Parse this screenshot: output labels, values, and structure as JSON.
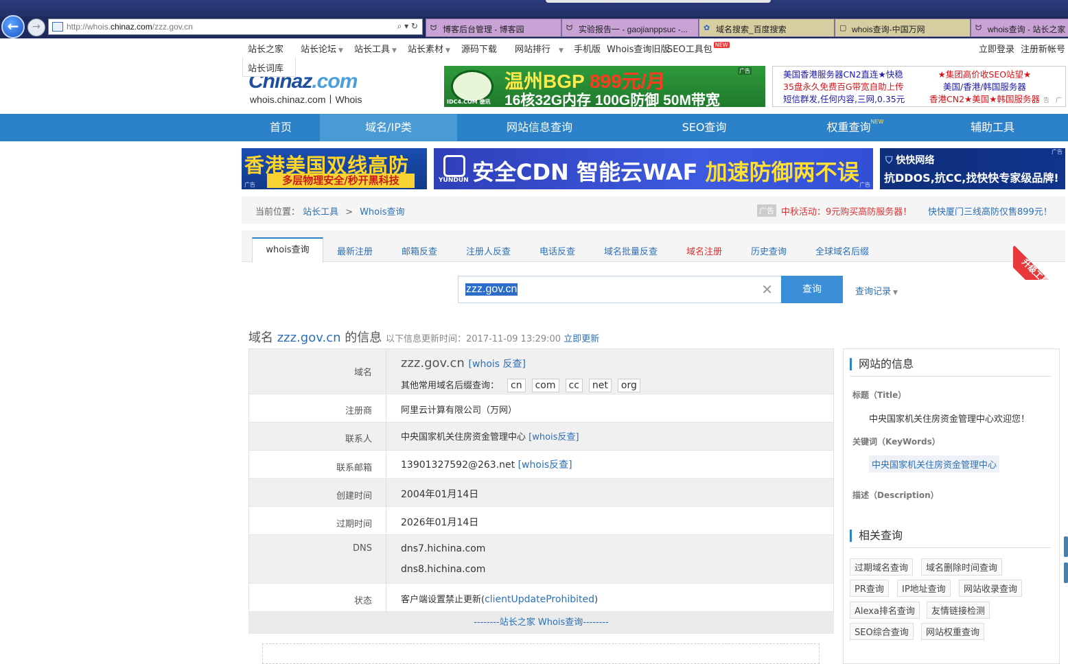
{
  "browser": {
    "url_prefix": "http://whois.",
    "url_domain": "chinaz.com",
    "url_path": "/zzz.gov.cn",
    "address_controls": "⌕ ▾ ↻",
    "tabs": [
      {
        "title": "博客后台管理 - 博客园",
        "icon": "ᗢ"
      },
      {
        "title": "实验报告一 - gaojianppsuc -...",
        "icon": "ᗢ"
      },
      {
        "title": "域名搜索_百度搜索",
        "icon": "✿"
      },
      {
        "title": "whois查询-中国万网",
        "icon": "▢"
      },
      {
        "title": "whois查询 - 站长之家",
        "icon": "ᗢ"
      }
    ]
  },
  "toplinks": {
    "items": [
      "站长之家",
      "站长论坛",
      "站长工具",
      "站长素材",
      "源码下载",
      "网站排行",
      "手机版",
      "Whois查询旧版",
      "SEO工具包"
    ],
    "new_badge": "NEW",
    "login": "立即登录",
    "register": "注册新帐号",
    "dropdown_item": "站长词库"
  },
  "logo": {
    "name": "Chinaz",
    "suffix": ".com",
    "sub": "whois.chinaz.com丨Whois"
  },
  "banner_bgp": {
    "line1_a": "温州BGP",
    "line1_b": "899元/月",
    "line2": "16核32G内存 100G防御 50M带宽",
    "brand": "IDC4.COM 德讯",
    "ad_label": "广告"
  },
  "text_ad": {
    "left": [
      "美国香港服务器CN2直连★快稳",
      "35盘永久免费百G带宽自助上传",
      "短信群发,任何内容,三网,0.35元"
    ],
    "right": [
      "★集团高价收SEO站望★",
      "美国/香港/韩国服务器",
      "香港CN2★美国★韩国服务器"
    ],
    "ad_label": "广告"
  },
  "main_nav": [
    "首页",
    "域名/IP类",
    "网站信息查询",
    "SEO查询",
    "权重查询",
    "辅助工具"
  ],
  "main_nav_new": "NEW",
  "ads": {
    "ad1_title": "香港美国双线高防",
    "ad1_sub": "多层物理安全/秒开黑科技",
    "ad2_brand": "YUNDUN",
    "ad2_text_a": "安全CDN 智能云WAF ",
    "ad2_text_b": "加速防御两不误",
    "ad3_brand": "快快网络",
    "ad3_text": "抗DDOS,抗CC,找快快专家级品牌!",
    "ad_label": "广告"
  },
  "breadcrumb": {
    "prefix": "当前位置：",
    "items": [
      "站长工具",
      "Whois查询"
    ],
    "sep": ">",
    "ad_tag": "广告",
    "promo1": "中秋活动：9元购买高防服务器！",
    "promo2": "快快厦门三线高防仅售899元！"
  },
  "tabs": [
    "whois查询",
    "最新注册",
    "邮箱反查",
    "注册人反查",
    "电话反查",
    "域名批量反查",
    "域名注册",
    "历史查询",
    "全球域名后缀"
  ],
  "vip_ribbon": "升级工具VIP",
  "search": {
    "value": "zzz.gov.cn",
    "button": "查询",
    "history": "查询记录"
  },
  "result": {
    "title_prefix": "域名",
    "domain": "zzz.gov.cn",
    "title_suffix": "的信息",
    "update_label": "以下信息更新时间：2017-11-09 13:29:00",
    "update_link": "立即更新"
  },
  "info": {
    "domain_label": "域名",
    "domain_value": "zzz.gov.cn",
    "whois_reverse": "[whois 反查]",
    "suffix_label": "其他常用域名后缀查询：",
    "suffixes": [
      "cn",
      "com",
      "cc",
      "net",
      "org"
    ],
    "registrar_label": "注册商",
    "registrar": "阿里云计算有限公司（万网）",
    "contact_label": "联系人",
    "contact": "中央国家机关住房资金管理中心",
    "contact_link": "[whois反查]",
    "email_label": "联系邮箱",
    "email": "13901327592@263.net",
    "email_link": "[whois反查]",
    "created_label": "创建时间",
    "created": "2004年01月14日",
    "expires_label": "过期时间",
    "expires": "2026年01月14日",
    "dns_label": "DNS",
    "dns": [
      "dns7.hichina.com",
      "dns8.hichina.com"
    ],
    "status_label": "状态",
    "status_text": "客户端设置禁止更新(",
    "status_code": "clientUpdateProhibited",
    "status_close": ")",
    "footer": "--------站长之家 Whois查询--------"
  },
  "sidebar": {
    "site_info_title": "网站的信息",
    "title_label": "标题（Title）",
    "title_value": "中央国家机关住房资金管理中心欢迎您！",
    "keywords_label": "关键词（KeyWords）",
    "keyword": "中央国家机关住房资金管理中心",
    "desc_label": "描述（Description）",
    "related_title": "相关查询",
    "related": [
      "过期域名查询",
      "域名删除时间查询",
      "PR查询",
      "IP地址查询",
      "网站收录查询",
      "Alexa排名查询",
      "友情链接检测",
      "SEO综合查询",
      "网站权重查询"
    ]
  }
}
